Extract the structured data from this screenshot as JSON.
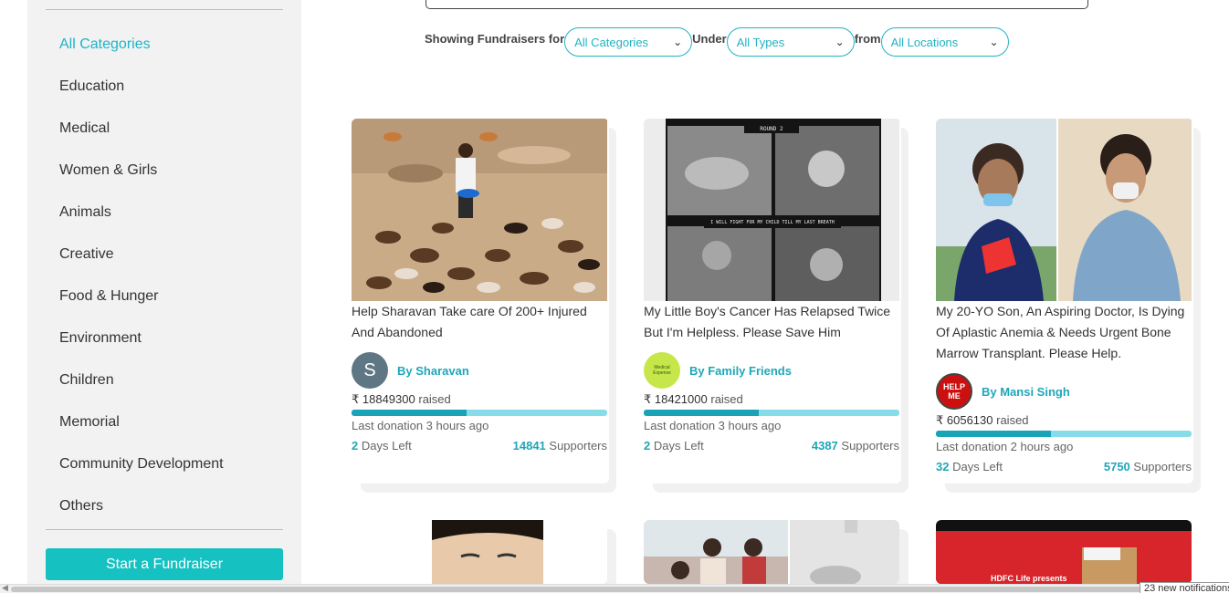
{
  "sidebar": {
    "categories": [
      {
        "label": "All Categories"
      },
      {
        "label": "Education"
      },
      {
        "label": "Medical"
      },
      {
        "label": "Women & Girls"
      },
      {
        "label": "Animals"
      },
      {
        "label": "Creative"
      },
      {
        "label": "Food & Hunger"
      },
      {
        "label": "Environment"
      },
      {
        "label": "Children"
      },
      {
        "label": "Memorial"
      },
      {
        "label": "Community Development"
      },
      {
        "label": "Others"
      }
    ],
    "active": "All Categories",
    "start_button": "Start a Fundraiser"
  },
  "filters": {
    "showing_label": "Showing Fundraisers for",
    "category_value": "All Categories",
    "under_label": "Under",
    "type_value": "All Types",
    "from_label": "from",
    "location_value": "All Locations"
  },
  "fundraisers": [
    {
      "title": "Help Sharavan Take care Of 200+ Injured And Abandoned",
      "author": "By Sharavan",
      "avatar_letter": "S",
      "raised_amount": "₹ 18849300",
      "raised_suffix": "raised",
      "progress": 0.45,
      "last_donation": "Last donation 3 hours ago",
      "days_value": "2",
      "days_label": "Days Left",
      "supporters_value": "14841",
      "supporters_label": "Supporters"
    },
    {
      "title": "My Little Boy's Cancer Has Relapsed Twice But I'm Helpless. Please Save Him",
      "author": "By Family Friends",
      "avatar_text": "Medical Expense",
      "raised_amount": "₹ 18421000",
      "raised_suffix": "raised",
      "progress": 0.45,
      "last_donation": "Last donation 3 hours ago",
      "days_value": "2",
      "days_label": "Days Left",
      "supporters_value": "4387",
      "supporters_label": "Supporters"
    },
    {
      "title": "My 20-YO Son, An Aspiring Doctor, Is Dying Of Aplastic Anemia & Needs Urgent Bone Marrow Transplant. Please Help.",
      "author": "By Mansi Singh",
      "avatar_text": "HELP ME",
      "raised_amount": "₹ 6056130",
      "raised_suffix": "raised",
      "progress": 0.45,
      "last_donation": "Last donation 2 hours ago",
      "days_value": "32",
      "days_label": "Days Left",
      "supporters_value": "5750",
      "supporters_label": "Supporters"
    }
  ],
  "image_texts": {
    "card2_caption_top": "ROUND 2",
    "card2_caption_mid": "I WILL FIGHT FOR MY CHILD TILL MY LAST BREATH",
    "card6_text": "HDFC Life presents"
  },
  "notification": "23 new notifications"
}
